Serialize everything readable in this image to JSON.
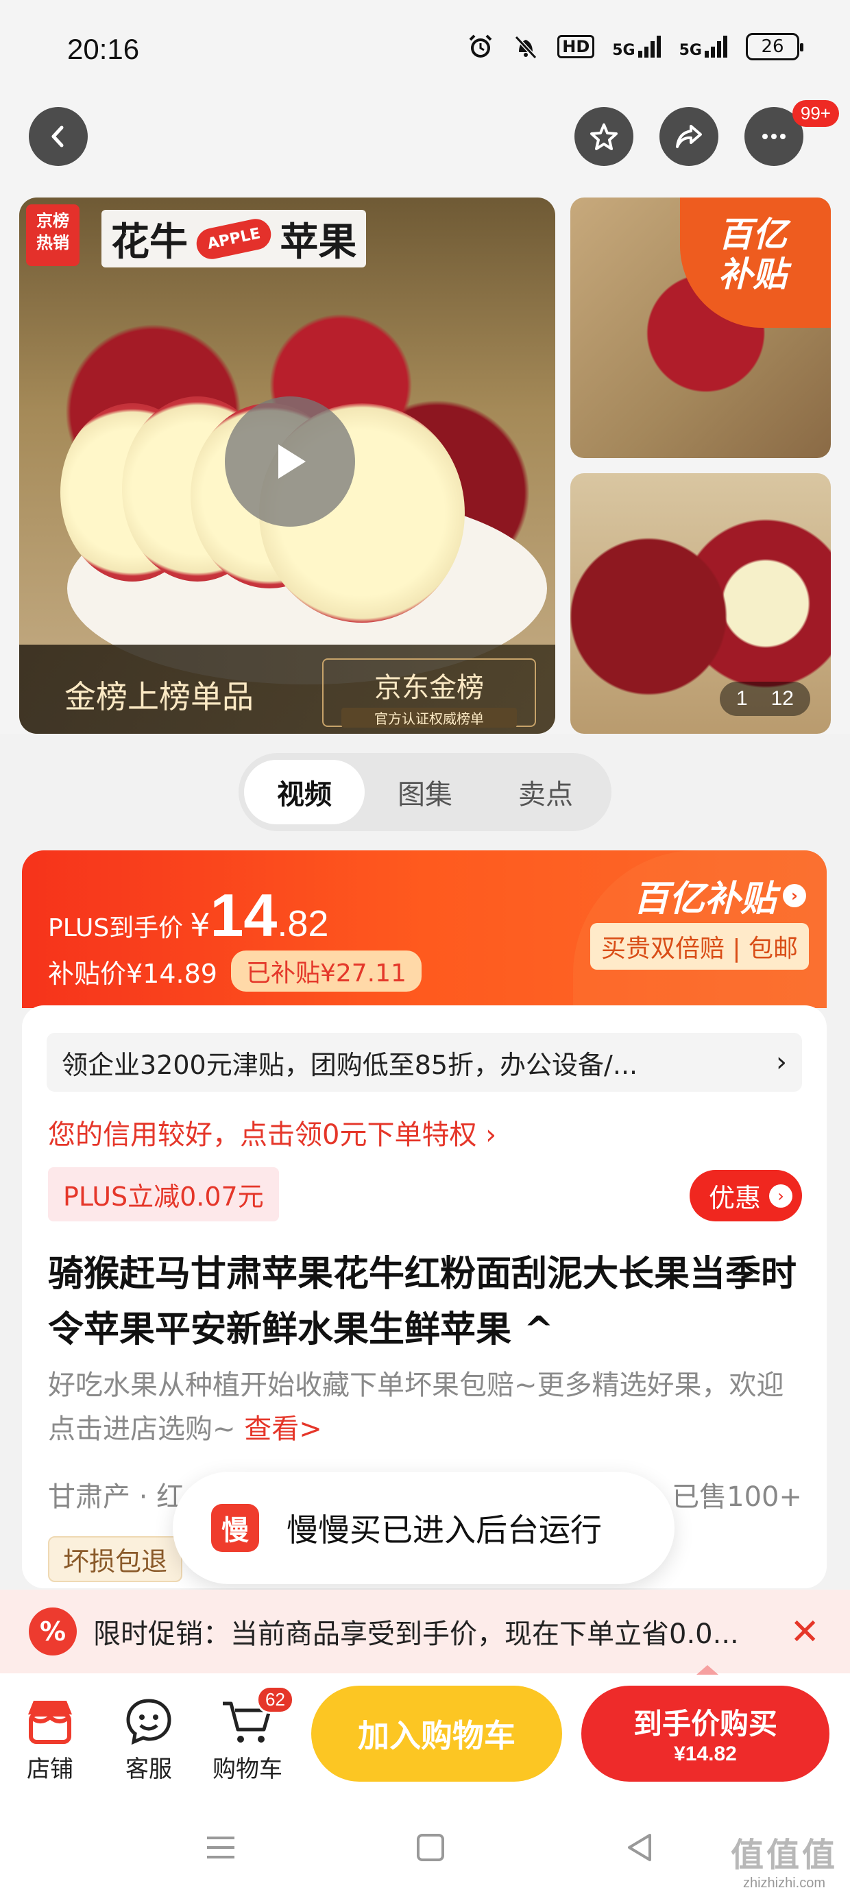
{
  "status_bar": {
    "time": "20:16",
    "hd_label": "HD",
    "net1": "5G",
    "net2": "5G",
    "battery": "26"
  },
  "nav": {
    "back_icon": "chevron-left-icon",
    "favorite_icon": "star-icon",
    "share_icon": "share-icon",
    "more_icon": "more-icon",
    "message_badge": "99+"
  },
  "gallery": {
    "hot_tag": "京榜\n热销",
    "title_left": "花牛",
    "title_pill": "APPLE",
    "title_right": "苹果",
    "banner_text": "金榜上榜单品",
    "jd_gold_title": "京东金榜",
    "jd_gold_sub": "官方认证权威榜单",
    "yi_corner": "百亿\n补贴",
    "counter_current": "1",
    "counter_total": "12"
  },
  "media_tabs": [
    {
      "label": "视频",
      "active": true
    },
    {
      "label": "图集",
      "active": false
    },
    {
      "label": "卖点",
      "active": false
    }
  ],
  "price": {
    "plus_label": "PLUS到手价",
    "yen": "¥",
    "int": "14",
    "dec": ".82",
    "subsidy_price": "补贴价¥14.89",
    "subsidy_pill": "已补贴¥27.11",
    "yi_logo": "百亿补贴",
    "guarantee": "买贵双倍赔 | 包邮"
  },
  "info": {
    "promo_bar": "领企业3200元津贴，团购低至85折，办公设备/...",
    "credit_line": "您的信用较好，点击领0元下单特权 ›",
    "plus_discount": "PLUS立减0.07元",
    "youhui": "优惠",
    "title": "骑猴赶马甘肃苹果花牛红粉面刮泥大长果当季时令苹果平安新鲜水果生鲜苹果 ^",
    "desc": "好吃水果从种植开始收藏下单坏果包赔~更多精选好果，欢迎点击进店选购~ ",
    "desc_link": "查看>",
    "origin": "甘肃产 · 红",
    "sold": "已售100+",
    "return_tag": "坏损包退"
  },
  "toast": {
    "icon_label": "慢",
    "text": "慢慢买已进入后台运行"
  },
  "limited": {
    "icon": "%",
    "text": "限时促销：当前商品享受到手价，现在下单立省0.0...",
    "close": "✕"
  },
  "actions": {
    "store": "店铺",
    "service": "客服",
    "cart": "购物车",
    "cart_count": "62",
    "add_cart": "加入购物车",
    "buy_line1": "到手价购买",
    "buy_line2": "¥14.82"
  },
  "watermark": {
    "line1": "值值值",
    "line2": "zhizhizhi.com"
  },
  "colors": {
    "accent_red": "#ee2b2a",
    "accent_orange": "#ff5a1e",
    "cart_yellow": "#fcc623"
  }
}
